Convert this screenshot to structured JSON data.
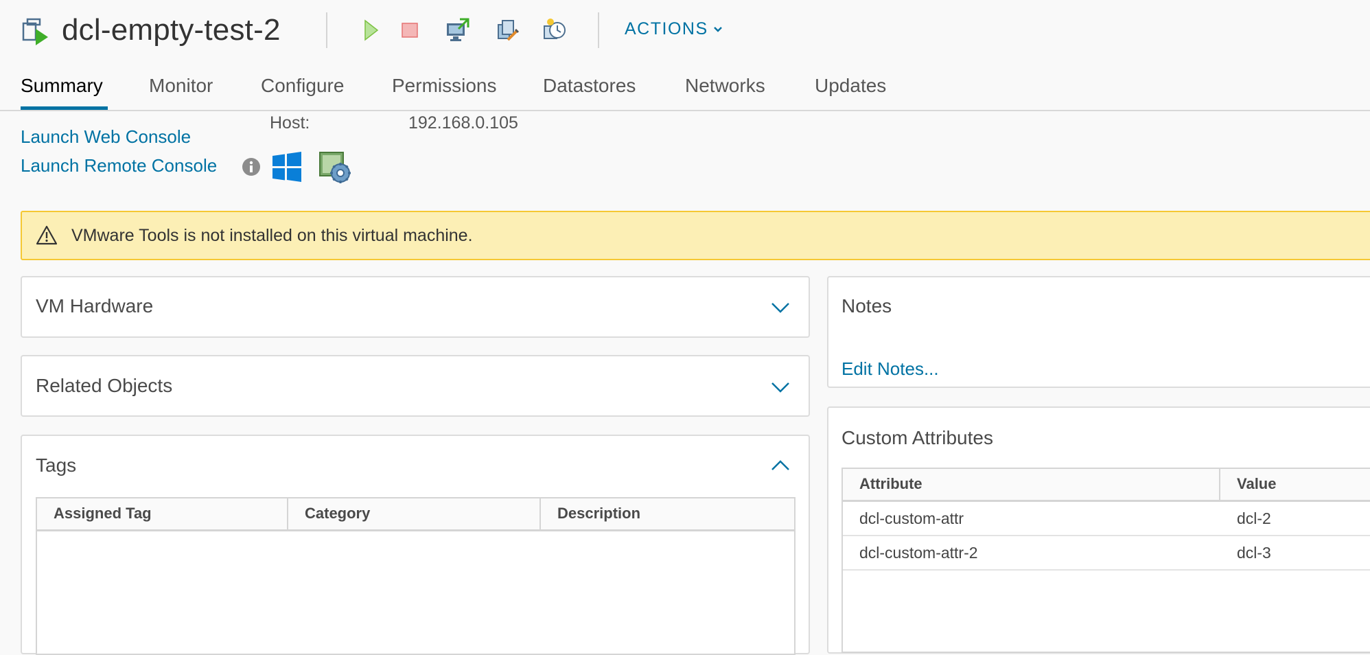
{
  "header": {
    "title": "dcl-empty-test-2",
    "actions_label": "ACTIONS",
    "toolbar_icons": [
      "power-on-icon",
      "power-off-icon",
      "open-console-icon",
      "migrate-icon",
      "snapshot-icon"
    ]
  },
  "tabs": [
    {
      "label": "Summary",
      "active": true
    },
    {
      "label": "Monitor"
    },
    {
      "label": "Configure"
    },
    {
      "label": "Permissions"
    },
    {
      "label": "Datastores"
    },
    {
      "label": "Networks"
    },
    {
      "label": "Updates"
    }
  ],
  "console": {
    "launch_web": "Launch Web Console",
    "launch_remote": "Launch Remote Console",
    "host_label": "Host:",
    "host_value": "192.168.0.105"
  },
  "alert": {
    "text": "VMware Tools is not installed on this virtual machine."
  },
  "cards": {
    "vm_hardware": "VM Hardware",
    "related_objects": "Related Objects",
    "tags": {
      "title": "Tags",
      "columns": [
        "Assigned Tag",
        "Category",
        "Description"
      ]
    },
    "notes": {
      "title": "Notes",
      "edit_label": "Edit Notes..."
    },
    "custom_attributes": {
      "title": "Custom Attributes",
      "columns": [
        "Attribute",
        "Value"
      ],
      "rows": [
        {
          "attribute": "dcl-custom-attr",
          "value": "dcl-2"
        },
        {
          "attribute": "dcl-custom-attr-2",
          "value": "dcl-3"
        }
      ]
    }
  },
  "colors": {
    "accent": "#0072a3",
    "alert_bg": "#fcefb5",
    "alert_border": "#f5c833",
    "power_on": "#7cc142",
    "power_off": "#e57373"
  }
}
